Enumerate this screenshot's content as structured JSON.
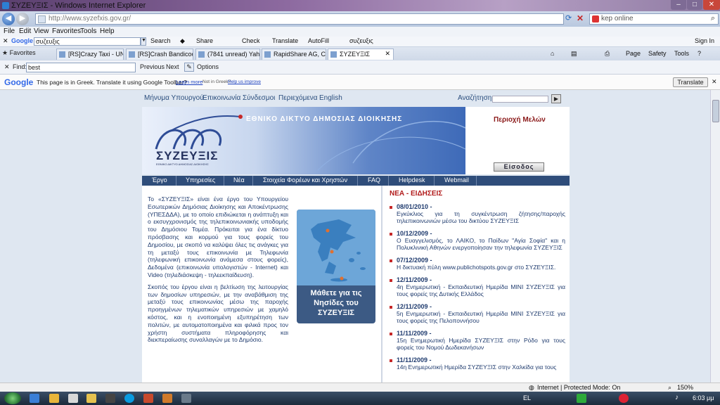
{
  "window": {
    "title": "ΣΥΖΕΥΞΙΣ - Windows Internet Explorer"
  },
  "address": {
    "url": "http://www.syzefxis.gov.gr/",
    "search_value": "kep online"
  },
  "menu": [
    "File",
    "Edit",
    "View",
    "Favorites",
    "Tools",
    "Help"
  ],
  "google_toolbar": {
    "search_value": "συζευξις",
    "items": [
      "Search",
      "Share",
      "Check",
      "Translate",
      "AutoFill",
      "συζευξις",
      "Sign In"
    ]
  },
  "favorites": {
    "label": "Favorites"
  },
  "tabs": [
    "[RS]Crazy Taxi - UN...",
    "[RS]Crash Bandicoo...",
    "(7841 unread) Yaho...",
    "RapidShare AG, Cha...",
    "ΣΥΖΕΥΞΙΣ"
  ],
  "commands": [
    "Page",
    "Safety",
    "Tools"
  ],
  "findbar": {
    "label": "Find:",
    "value": "best",
    "previous": "Previous",
    "next": "Next",
    "options": "Options"
  },
  "translate_bar": {
    "brand": "Google",
    "message": "This page is in Greek.  Translate it using Google Toolbar?",
    "learn_more": "Learn more",
    "not_greek": "Not in Greek?",
    "help_us": "Help us improve",
    "button": "Translate"
  },
  "site": {
    "topnav": [
      "Μήνυμα Υπουργού",
      "Επικοινωνία",
      "Σύνδεσμοι",
      "Περιεχόμενα",
      "English"
    ],
    "search_label": "Αναζήτηση:",
    "banner_title": "ΕΘΝΙΚΟ ΔΙΚΤΥΟ ΔΗΜΟΣΙΑΣ ΔΙΟΙΚΗΣΗΣ",
    "logo": "ΣΥΖΕΥΞΙΣ",
    "logo_sub": "ΕΘΝΙΚΟ ΔΙΚΤΥΟ ΔΗΜΟΣΙΑΣ ΔΙΟΙΚΗΣΗΣ",
    "members_title": "Περιοχή Μελών",
    "login": "Είσοδος",
    "mainnav": [
      "Έργο",
      "Υπηρεσίες",
      "Νέα",
      "Στοιχεία Φορέων και Χρηστών",
      "FAQ",
      "Helpdesk",
      "Webmail"
    ],
    "intro_p1": "Το «ΣΥΖΕΥΞΙΣ» είναι ένα έργο του Υπουργείου Εσωτερικών Δημόσιας Διοίκησης και Αποκέντρωσης (ΥΠΕΣΔΔΑ), με το οποίο επιδιώκεται η ανάπτυξη και ο εκσυγχρονισμός της τηλεπικοινωνιακής υποδομής του Δημόσιου Τομέα. Πρόκειται για ένα δίκτυο πρόσβασης και κορμού για τους φορείς του Δημοσίου, με σκοπό να καλύψει όλες τις ανάγκες για τη μεταξύ τους επικοινωνία με Τηλεφωνία (τηλεφωνική επικοινωνία ανάμεσα στους φορείς), Δεδομένα (επικοινωνία υπολογιστών - Internet) και Video (τηλεδιάσκεψη - τηλεεκπαίδευση).",
    "intro_p2": "Σκοπός του έργου είναι η βελτίωση της λειτουργίας των δημοσίων υπηρεσιών, με την αναβάθμιση της μεταξύ τους επικοινωνίας μέσω της παροχής προηγμένων τηλεματικών υπηρεσιών με χαμηλό κόστος, και η ενοποιημένη εξυπηρέτηση των πολιτών, με αυτοματοποιημένα και φιλικά προς τον χρήστη συστήματα πληροφόρησης και διεκπεραίωσης συναλλαγών με το Δημόσιο.",
    "islands_text": "Μάθετε για τις Νησίδες του ΣΥΖΕΥΞΙΣ",
    "news_title": "ΝΕΑ - ΕΙΔΗΣΕΙΣ",
    "news": [
      {
        "date": "08/01/2010 -",
        "text": "Εγκύκλιος για τη συγκέντρωση ζήτησης/παροχής τηλεπικοινωνιών μέσω του δικτύου ΣΥΖΕΥΞΙΣ"
      },
      {
        "date": "10/12/2009 -",
        "text": "Ο Ευαγγελισμός, το ΛΑΙΚΟ, το Παίδων \"Αγία Σοφία\" και η Πολυκλινική Αθηνών ενεργοποίησαν την τηλεφωνία ΣΥΖΕΥΞΙΣ"
      },
      {
        "date": "07/12/2009 -",
        "text": "Η δικτυακή πύλη www.publichotspots.gov.gr στο ΣΥΖΕΥΞΙΣ."
      },
      {
        "date": "12/11/2009 -",
        "text": "4η Ενημερωτική - Εκπαιδευτική Ημερίδα ΜΙΝΙ ΣΥΖΕΥΞΙΣ για τους φορείς της Δυτικής Ελλάδος"
      },
      {
        "date": "12/11/2009 -",
        "text": "5η Ενημερωτική - Εκπαιδευτική Ημερίδα ΜΙΝΙ ΣΥΖΕΥΞΙΣ για τους φορείς της Πελοποννήσου"
      },
      {
        "date": "11/11/2009 -",
        "text": "15η Ενημερωτική Ημερίδα ΣΥΖΕΥΞΙΣ στην Ρόδο για τους φορείς του Νομού Δωδεκανήσων"
      },
      {
        "date": "11/11/2009 -",
        "text": "14η Ενημερωτική Ημερίδα ΣΥΖΕΥΞΙΣ στην Χαλκίδα για τους"
      }
    ]
  },
  "status": {
    "zone": "Internet | Protected Mode: On",
    "zoom": "150%"
  },
  "taskbar": {
    "lang": "EL",
    "time": "6:03 μμ"
  },
  "colors": {
    "nav_blue": "#2f4d7a",
    "news_red": "#b11b1b",
    "text_blue": "#1f3b6e"
  }
}
